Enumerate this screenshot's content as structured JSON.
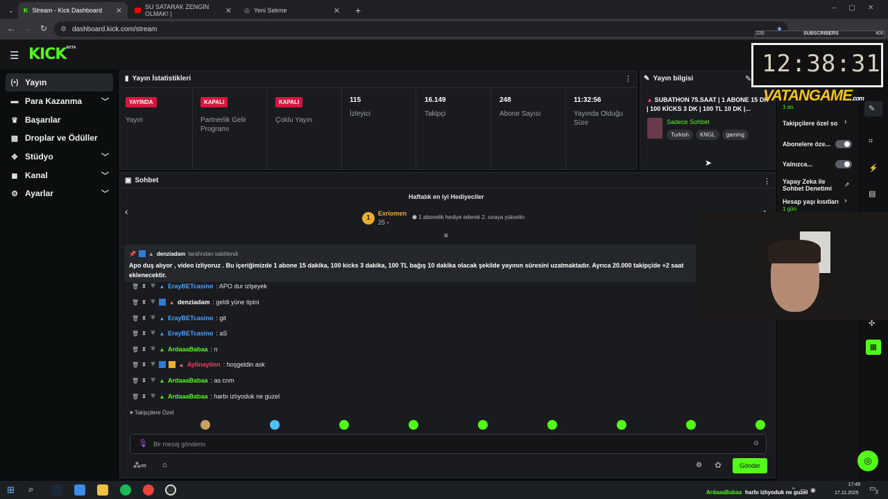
{
  "browser": {
    "tabs": [
      {
        "title": "Stream - Kick Dashboard",
        "active": true
      },
      {
        "title": "SU SATARAK ZENGİN OLMAK! |",
        "active": false
      },
      {
        "title": "Yeni Sekme",
        "active": false
      }
    ],
    "url": "dashboard.kick.com/stream"
  },
  "brand": {
    "logo": "KICK",
    "logo_sup": "BETA",
    "accent": "#53fc18"
  },
  "sidebar": {
    "items": [
      {
        "label": "Yayın",
        "icon": "broadcast-icon",
        "active": true,
        "expandable": false
      },
      {
        "label": "Para Kazanma",
        "icon": "money-icon",
        "active": false,
        "expandable": true
      },
      {
        "label": "Başarılar",
        "icon": "trophy-icon",
        "active": false,
        "expandable": false
      },
      {
        "label": "Droplar ve Ödüller",
        "icon": "gift-icon",
        "active": false,
        "expandable": false
      },
      {
        "label": "Stüdyo",
        "icon": "studio-icon",
        "active": false,
        "expandable": true
      },
      {
        "label": "Kanal",
        "icon": "channel-icon",
        "active": false,
        "expandable": true
      },
      {
        "label": "Ayarlar",
        "icon": "gear-icon",
        "active": false,
        "expandable": true
      }
    ]
  },
  "stats": {
    "title": "Yayın İstatistikleri",
    "columns": [
      {
        "badge": "YAYINDA",
        "label": "Yayın"
      },
      {
        "badge": "KAPALI",
        "label": "Partnerlik Gelir Programı"
      },
      {
        "badge": "KAPALI",
        "label": "Çoklu Yayın"
      },
      {
        "value": "115",
        "label": "İzleyici"
      },
      {
        "value": "16.149",
        "label": "Takipçi"
      },
      {
        "value": "248",
        "label": "Abone Sayısı"
      },
      {
        "value": "11:32:56",
        "label": "Yayında Olduğu Süre"
      }
    ]
  },
  "stream_info": {
    "title": "Yayın bilgisi",
    "stream_title": "SUBATHON 75.SAAT | 1 ABONE 15 DK | 100 KİCKS 3 DK | 100 TL 10 DK |...",
    "category": "Sadece Sohbet",
    "tags": [
      "Turkish",
      "KNGL",
      "gaming"
    ]
  },
  "chat": {
    "title": "Sohbet",
    "gifters_title": "Haftalık en iyi Hediyeciler",
    "top_gifter": {
      "rank": "1",
      "name": "Exriomen",
      "count": "25"
    },
    "gift_hint": "1 abonelik hediye ederek 2. sıraya yükselin",
    "pinned": {
      "by": "denziadam",
      "by_suffix": "tarafından sabitlendi",
      "text": "Apo duş alıyor , video izliyoruz . Bu içeriğimizde 1 abone 15 dakika, 100 kicks 3 dakika, 100 TL bağış 10 dakika olacak şekilde yayının süresini uzatmaktadır. Ayrıca 20.000 takipçide +2 saat eklenecektir."
    },
    "messages": [
      {
        "user": "ErayBETcasino",
        "text": ": APO dur izlşeyek",
        "color": "#4aa3ff"
      },
      {
        "user": "denziadam",
        "text": ": geldi yüne tipini",
        "color": "#ffffff"
      },
      {
        "user": "ErayBETcasino",
        "text": ": git",
        "color": "#4aa3ff"
      },
      {
        "user": "ErayBETcasino",
        "text": ": aS",
        "color": "#4aa3ff"
      },
      {
        "user": "ArdaaaBabaa",
        "text": ": n",
        "color": "#53fc18"
      },
      {
        "user": "Aylinaylinn",
        "text": ": hoşgeldin ask",
        "color": "#ff3b5c"
      },
      {
        "user": "ArdaaaBabaa",
        "text": ": as cnm",
        "color": "#53fc18"
      },
      {
        "user": "ArdaaaBabaa",
        "text": ": harbı izlıyoduk ne guzel",
        "color": "#53fc18"
      }
    ],
    "emote_section": "Takipçilere Özel",
    "input_placeholder": "Bir mesaj gönderin",
    "send_label": "Gönder"
  },
  "right_panel": {
    "items": [
      {
        "label": "Takipçilere özel so",
        "control": "chevron"
      },
      {
        "label": "Abonelere öze...",
        "control": "toggle"
      },
      {
        "label": "Yalnızca...",
        "control": "toggle"
      },
      {
        "label": "Yapay Zeka ile Sohbet Denetimi",
        "control": "external"
      },
      {
        "label": "Hesap yaşı kısıtları",
        "sub": "1 gün",
        "control": "chevron"
      }
    ],
    "slow_mode_sub": "1 sn."
  },
  "overlay": {
    "counter_left": "220",
    "counter_label": "SUBSCRIBERS",
    "counter_right": "400",
    "timer": "12:38:31",
    "watermark": "VATANGAME",
    "watermark_suffix": ".com"
  },
  "taskbar": {
    "ticker_user": "ArdaaaBabaa",
    "ticker_text": "harbı izlıyoduk ne guzel",
    "time": "17:49",
    "date": "17.11.2025",
    "notifications": "2"
  }
}
